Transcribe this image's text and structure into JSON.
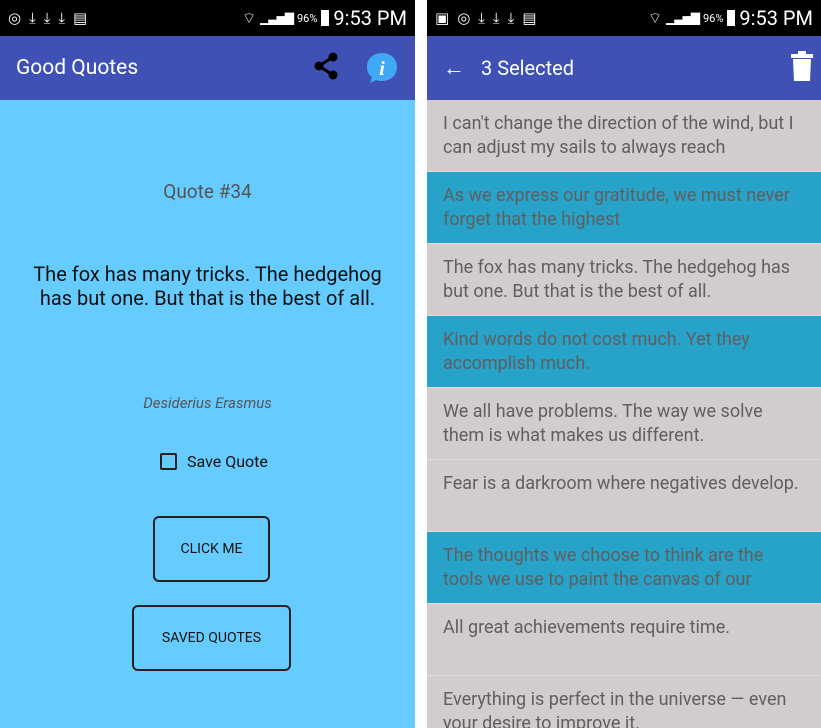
{
  "left": {
    "status": {
      "icons_left": [
        "◎",
        "⤓",
        "⤓",
        "⤓",
        "▤"
      ],
      "signal": "📶",
      "battery": "96%",
      "time": "9:53 PM"
    },
    "appbar": {
      "title": "Good Quotes",
      "share_icon": "share-icon",
      "info_label": "i"
    },
    "content": {
      "quote_number": "Quote #34",
      "quote_text": "The fox has many tricks. The hedgehog has but one. But that is the best of all.",
      "author": "Desiderius Erasmus",
      "save_label": "Save Quote",
      "click_label": "CLICK ME",
      "saved_label": "SAVED QUOTES"
    }
  },
  "right": {
    "status": {
      "icons_left": [
        "▣",
        "◎",
        "⤓",
        "⤓",
        "⤓",
        "▤"
      ],
      "battery": "96%",
      "time": "9:53 PM"
    },
    "appbar": {
      "back": "←",
      "title": "3 Selected",
      "delete_icon": "trash-icon"
    },
    "list": [
      {
        "text": "I can't change the direction of the wind, but I can adjust my sails to always reach",
        "selected": false
      },
      {
        "text": "As we express our gratitude, we must never forget that the highest",
        "selected": true
      },
      {
        "text": "The fox has many tricks. The hedgehog has but one. But that is the best of all.",
        "selected": false
      },
      {
        "text": "Kind words do not cost much. Yet they accomplish much.",
        "selected": true
      },
      {
        "text": "We all have problems. The way we solve them is what makes us different.",
        "selected": false
      },
      {
        "text": "Fear is a darkroom where negatives develop.",
        "selected": false
      },
      {
        "text": "The thoughts we choose to think are the tools we use to paint the canvas of our",
        "selected": true
      },
      {
        "text": "All great achievements require time.",
        "selected": false
      },
      {
        "text": "Everything is perfect in the universe — even your desire to improve it.",
        "selected": false
      }
    ]
  }
}
